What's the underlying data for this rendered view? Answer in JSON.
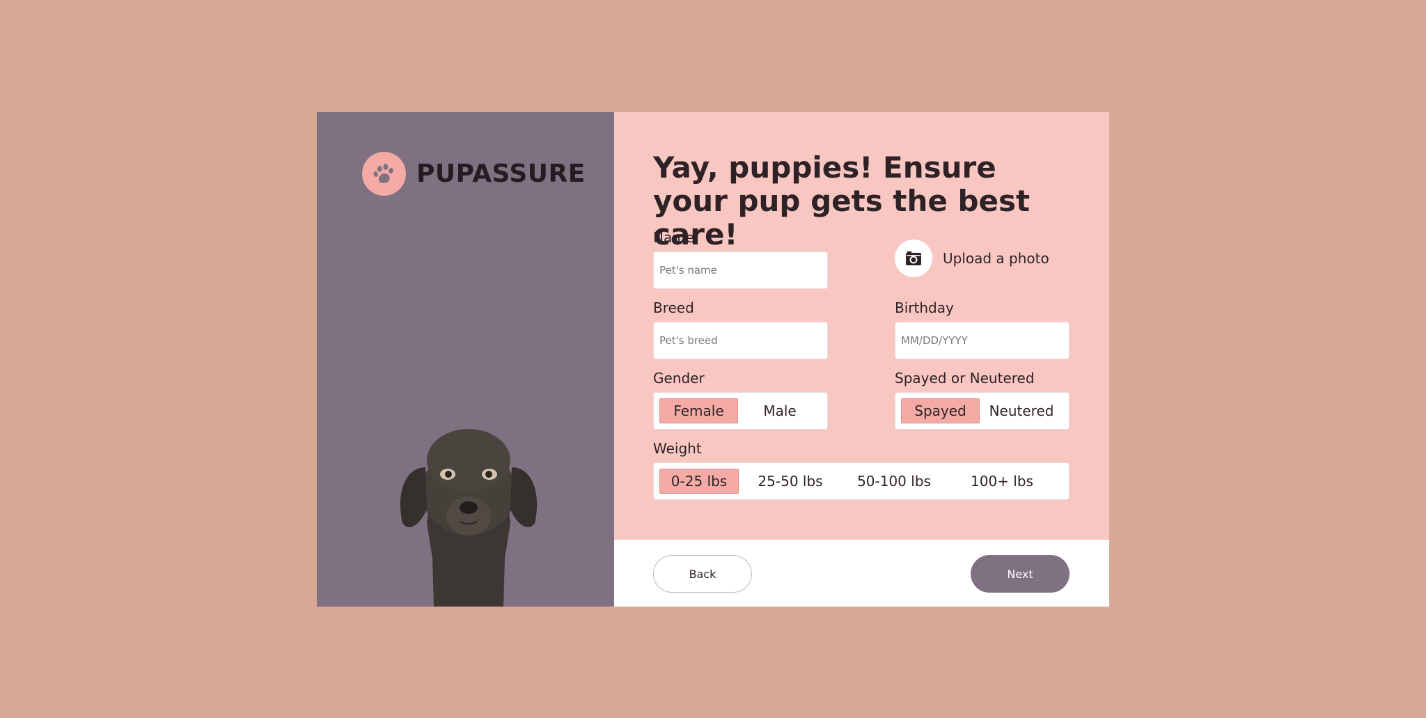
{
  "brand": {
    "name": "PUPASSURE",
    "icon": "paw-icon",
    "icon_bg": "#f4aba6"
  },
  "colors": {
    "page_bg": "#d9a996",
    "panel_bg": "#7f7182",
    "form_bg": "#f9c7c2",
    "accent": "#f4aba6"
  },
  "form": {
    "title": "Yay, puppies! Ensure your pup gets the best care!",
    "name": {
      "label": "Name",
      "placeholder": "Pet's name",
      "value": ""
    },
    "upload": {
      "label": "Upload a photo",
      "icon": "camera-icon"
    },
    "breed": {
      "label": "Breed",
      "placeholder": "Pet's breed",
      "value": ""
    },
    "birthday": {
      "label": "Birthday",
      "placeholder": "MM/DD/YYYY",
      "value": ""
    },
    "gender": {
      "label": "Gender",
      "options": [
        "Female",
        "Male"
      ],
      "selected": "Female"
    },
    "spayed": {
      "label": "Spayed or Neutered",
      "options": [
        "Spayed",
        "Neutered"
      ],
      "selected": "Spayed"
    },
    "weight": {
      "label": "Weight",
      "options": [
        "0-25 lbs",
        "25-50 lbs",
        "50-100 lbs",
        "100+ lbs"
      ],
      "selected": "0-25 lbs"
    }
  },
  "footer": {
    "back_label": "Back",
    "next_label": "Next"
  }
}
